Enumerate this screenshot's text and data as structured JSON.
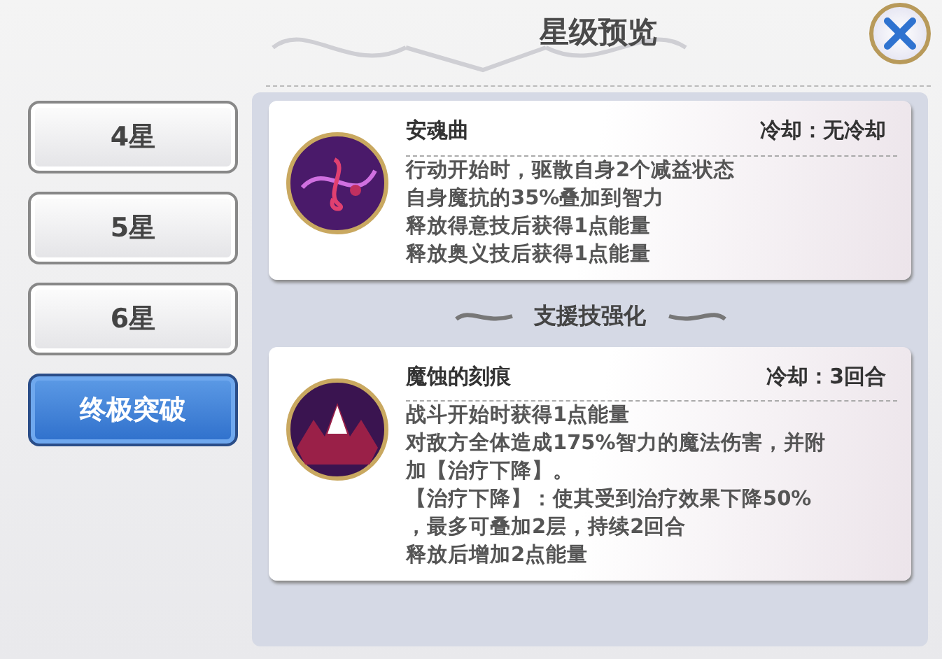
{
  "window": {
    "title": "星级预览"
  },
  "tabs": [
    {
      "label": "4星",
      "selected": false
    },
    {
      "label": "5星",
      "selected": false
    },
    {
      "label": "6星",
      "selected": false
    },
    {
      "label": "终极突破",
      "selected": true
    }
  ],
  "skills": [
    {
      "name": "安魂曲",
      "cooldown": "冷却：无冷却",
      "lines": [
        "行动开始时，驱散自身2个减益状态",
        "自身魔抗的35%叠加到智力",
        "释放得意技后获得1点能量",
        "释放奥义技后获得1点能量"
      ]
    },
    {
      "section": "支援技强化",
      "name": "魔蚀的刻痕",
      "cooldown": "冷却：3回合",
      "lines": [
        "战斗开始时获得1点能量",
        "对敌方全体造成175%智力的魔法伤害，并附",
        "加【治疗下降】。",
        "【治疗下降】：使其受到治疗效果下降50%",
        "，最多可叠加2层，持续2回合",
        "释放后增加2点能量"
      ]
    }
  ]
}
